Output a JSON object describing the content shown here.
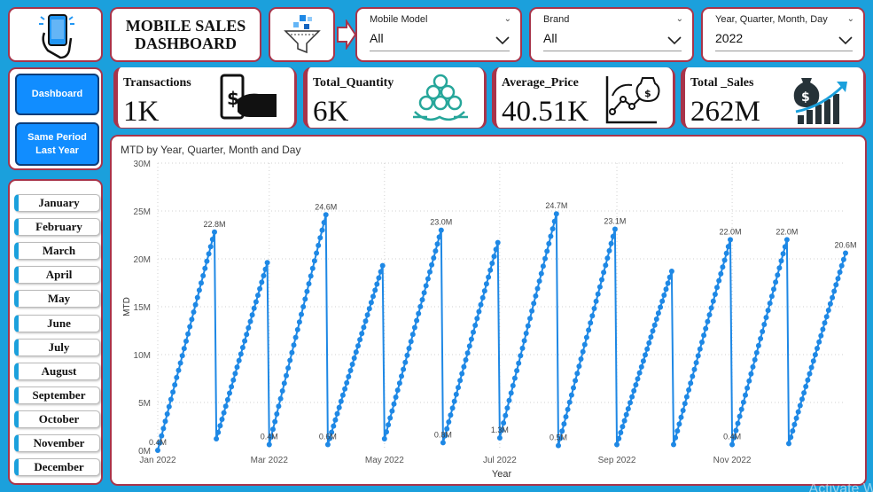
{
  "header": {
    "title_line1": "MOBILE SALES",
    "title_line2": "DASHBOARD"
  },
  "icons": {
    "logo": "phone-hand-icon",
    "filter": "funnel-icon",
    "arrow": "arrow-right-icon"
  },
  "slicers": [
    {
      "label": "Mobile Model",
      "value": "All"
    },
    {
      "label": "Brand",
      "value": "All"
    },
    {
      "label": "Year, Quarter, Month, Day",
      "value": "2022"
    }
  ],
  "nav": {
    "dashboard": "Dashboard",
    "same_period": "Same Period Last Year"
  },
  "months": [
    "January",
    "February",
    "March",
    "April",
    "May",
    "June",
    "July",
    "August",
    "September",
    "October",
    "November",
    "December"
  ],
  "kpis": [
    {
      "label": "Transactions",
      "value": "1K",
      "icon": "cash-payment-icon"
    },
    {
      "label": "Total_Quantity",
      "value": "6K",
      "icon": "coin-stack-icon"
    },
    {
      "label": "Average_Price",
      "value": "40.51K",
      "icon": "price-trend-icon"
    },
    {
      "label": "Total _Sales",
      "value": "262M",
      "icon": "money-growth-icon"
    }
  ],
  "colors": {
    "accent": "#1ba0dc",
    "border": "#a8344a",
    "series": "#1e88e5",
    "button": "#118dff"
  },
  "watermark": "Activate W",
  "chart_data": {
    "type": "line",
    "title": "MTD by Year, Quarter, Month and Day",
    "xlabel": "Year",
    "ylabel": "MTD",
    "ylim": [
      0,
      30000000
    ],
    "y_ticks": [
      "0M",
      "5M",
      "10M",
      "15M",
      "20M",
      "25M",
      "30M"
    ],
    "x_ticks": [
      "Jan 2022",
      "Mar 2022",
      "May 2022",
      "Jul 2022",
      "Sep 2022",
      "Nov 2022"
    ],
    "grid": true,
    "months": [
      {
        "month": "Jan 2022",
        "start": 0.0,
        "end": 22.8
      },
      {
        "month": "Feb 2022",
        "start": 1.2,
        "end": 19.6
      },
      {
        "month": "Mar 2022",
        "start": 0.6,
        "end": 24.6
      },
      {
        "month": "Apr 2022",
        "start": 0.6,
        "end": 19.3
      },
      {
        "month": "May 2022",
        "start": 1.2,
        "end": 23.0
      },
      {
        "month": "Jun 2022",
        "start": 0.8,
        "end": 21.7
      },
      {
        "month": "Jul 2022",
        "start": 1.3,
        "end": 24.7
      },
      {
        "month": "Aug 2022",
        "start": 0.5,
        "end": 23.1
      },
      {
        "month": "Sep 2022",
        "start": 0.6,
        "end": 18.7
      },
      {
        "month": "Oct 2022",
        "start": 0.6,
        "end": 22.0
      },
      {
        "month": "Nov 2022",
        "start": 0.6,
        "end": 22.0
      },
      {
        "month": "Dec 2022",
        "start": 0.7,
        "end": 20.6
      }
    ],
    "data_labels": [
      {
        "month": "Jan 2022",
        "position": "start",
        "text": "0.4M"
      },
      {
        "month": "Jan 2022",
        "position": "end",
        "text": "22.8M"
      },
      {
        "month": "Mar 2022",
        "position": "start",
        "text": "0.4M"
      },
      {
        "month": "Mar 2022",
        "position": "end",
        "text": "24.6M"
      },
      {
        "month": "Apr 2022",
        "position": "start",
        "text": "0.6M"
      },
      {
        "month": "May 2022",
        "position": "end",
        "text": "23.0M"
      },
      {
        "month": "Jun 2022",
        "position": "start",
        "text": "0.8M"
      },
      {
        "month": "Jul 2022",
        "position": "start",
        "text": "1.3M"
      },
      {
        "month": "Jul 2022",
        "position": "end",
        "text": "24.7M"
      },
      {
        "month": "Aug 2022",
        "position": "start",
        "text": "0.5M"
      },
      {
        "month": "Aug 2022",
        "position": "end",
        "text": "23.1M"
      },
      {
        "month": "Nov 2022",
        "position": "start",
        "text": "0.4M"
      },
      {
        "month": "Oct 2022",
        "position": "end",
        "text": "22.0M"
      },
      {
        "month": "Nov 2022",
        "position": "end",
        "text": "22.0M"
      },
      {
        "month": "Dec 2022",
        "position": "end",
        "text": "20.6M"
      }
    ]
  }
}
